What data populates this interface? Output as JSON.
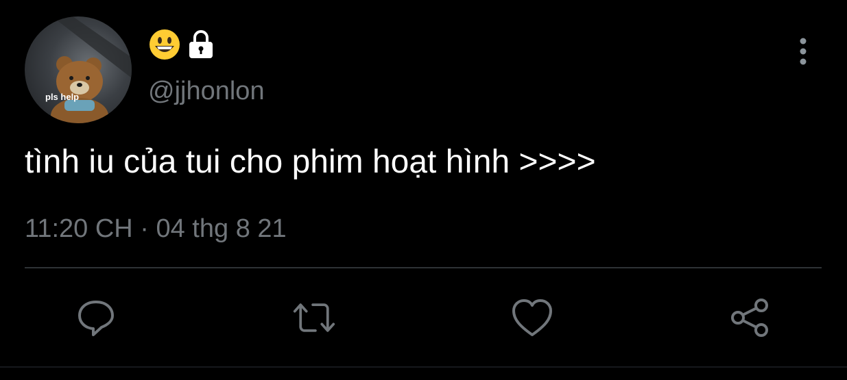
{
  "user": {
    "display_name_icons": [
      "grinning-face-emoji",
      "lock-icon"
    ],
    "handle": "@jjhonlon",
    "avatar_caption": "pls help"
  },
  "tweet": {
    "text": "tình iu của tui cho phim hoạt hình >>>>",
    "timestamp": "11:20 CH · 04 thg 8 21"
  },
  "actions": [
    {
      "name": "reply",
      "icon": "speech-bubble-icon"
    },
    {
      "name": "retweet",
      "icon": "retweet-icon"
    },
    {
      "name": "like",
      "icon": "heart-icon"
    },
    {
      "name": "share",
      "icon": "share-icon"
    }
  ],
  "colors": {
    "background": "#000000",
    "text": "#ffffff",
    "secondary": "#71767b",
    "divider": "#2f3336"
  }
}
